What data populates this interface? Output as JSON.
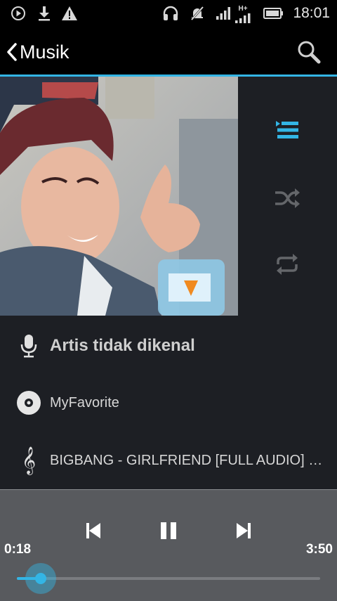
{
  "status_bar": {
    "time": "18:01",
    "network_type": "H+",
    "icons": [
      "play-notification-icon",
      "download-icon",
      "warning-icon",
      "headset-icon",
      "muted-icon",
      "signal-icon",
      "signal-hplus-icon",
      "battery-icon"
    ]
  },
  "action_bar": {
    "title": "Musik",
    "back_icon": "chevron-left-icon",
    "search_icon": "search-icon"
  },
  "album_art": {
    "description_icon": "album-art-image"
  },
  "side_controls": {
    "queue_icon": "queue-list-icon",
    "shuffle_icon": "shuffle-icon",
    "repeat_icon": "repeat-icon"
  },
  "track_info": {
    "artist": "Artis tidak dikenal",
    "album": "MyFavorite",
    "title": "BIGBANG - GIRLFRIEND [FULL AUDIO] MA..."
  },
  "player": {
    "elapsed": "0:18",
    "duration": "3:50",
    "progress_fraction": 0.078
  },
  "colors": {
    "accent": "#33b5e5",
    "panel": "#1d1f24",
    "player_bg": "#585a5e"
  }
}
